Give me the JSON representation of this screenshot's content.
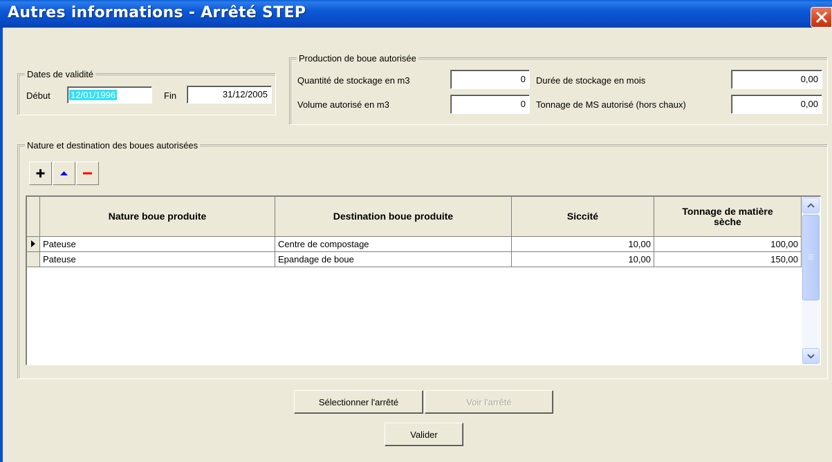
{
  "window": {
    "title": "Autres informations - Arrêté STEP"
  },
  "dates": {
    "legend": "Dates de validité",
    "debut_label": "Début",
    "debut_value": "12/01/1996",
    "fin_label": "Fin",
    "fin_value": "31/12/2005"
  },
  "production": {
    "legend": "Production de boue autorisée",
    "quantite_label": "Quantité de stockage en m3",
    "quantite_value": "0",
    "duree_label": "Durée de stockage en mois",
    "duree_value": "0,00",
    "volume_label": "Volume autorisé en m3",
    "volume_value": "0",
    "tonnage_label": "Tonnage de MS autorisé (hors chaux)",
    "tonnage_value": "0,00"
  },
  "nature": {
    "legend": "Nature et destination des boues autorisées",
    "toolbar": {
      "add_icon": "plus-icon",
      "up_icon": "up-arrow-icon",
      "remove_icon": "minus-icon"
    },
    "columns": [
      "Nature boue produite",
      "Destination boue produite",
      "Siccité",
      "Tonnage de matière sèche"
    ],
    "rows": [
      [
        "Pateuse",
        "Centre de compostage",
        "10,00",
        "100,00"
      ],
      [
        "Pateuse",
        "Epandage de boue",
        "10,00",
        "150,00"
      ]
    ]
  },
  "buttons": {
    "selectionner": "Sélectionner l'arrêté",
    "voir": "Voir l'arrêté",
    "valider": "Valider"
  },
  "colors": {
    "titlebar": "#0A58D6",
    "window_bg": "#ECE9D8",
    "selection": "#2FE0F8"
  }
}
